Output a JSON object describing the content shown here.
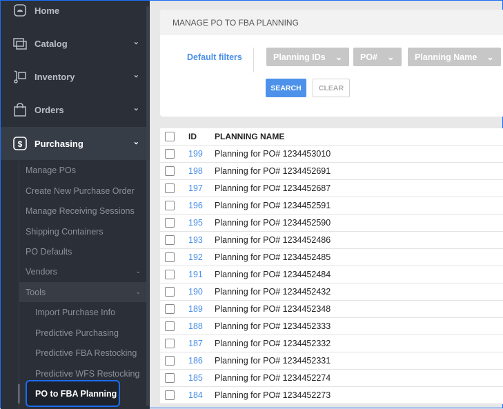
{
  "sidebar": {
    "top_items": [
      {
        "label": "Home",
        "icon": "home-icon"
      },
      {
        "label": "Catalog",
        "icon": "catalog-icon"
      },
      {
        "label": "Inventory",
        "icon": "inventory-icon"
      },
      {
        "label": "Orders",
        "icon": "orders-icon"
      },
      {
        "label": "Purchasing",
        "icon": "dollar-icon"
      }
    ],
    "sub_items": [
      "Manage POs",
      "Create New Purchase Order",
      "Manage Receiving Sessions",
      "Shipping Containers",
      "PO Defaults",
      "Vendors",
      "Tools"
    ],
    "tools_items": [
      "Import Purchase Info",
      "Predictive Purchasing",
      "Predictive FBA Restocking",
      "Predictive WFS Restocking"
    ],
    "active_item": "PO to FBA Planning"
  },
  "card": {
    "title": "MANAGE PO TO FBA PLANNING",
    "default_filters": "Default filters",
    "filters": [
      "Planning IDs",
      "PO#",
      "Planning Name"
    ],
    "search": "SEARCH",
    "clear": "CLEAR"
  },
  "table": {
    "headers": {
      "id": "ID",
      "name": "PLANNING NAME"
    },
    "rows": [
      {
        "id": "199",
        "name": "Planning for PO# 1234453010"
      },
      {
        "id": "198",
        "name": "Planning for PO# 1234452691"
      },
      {
        "id": "197",
        "name": "Planning for PO# 1234452687"
      },
      {
        "id": "196",
        "name": "Planning for PO# 1234452591"
      },
      {
        "id": "195",
        "name": "Planning for PO# 1234452590"
      },
      {
        "id": "193",
        "name": "Planning for PO# 1234452486"
      },
      {
        "id": "192",
        "name": "Planning for PO# 1234452485"
      },
      {
        "id": "191",
        "name": "Planning for PO# 1234452484"
      },
      {
        "id": "190",
        "name": "Planning for PO# 1234452432"
      },
      {
        "id": "189",
        "name": "Planning for PO# 1234452348"
      },
      {
        "id": "188",
        "name": "Planning for PO# 1234452333"
      },
      {
        "id": "187",
        "name": "Planning for PO# 1234452332"
      },
      {
        "id": "186",
        "name": "Planning for PO# 1234452331"
      },
      {
        "id": "185",
        "name": "Planning for PO# 1234452274"
      },
      {
        "id": "184",
        "name": "Planning for PO# 1234452273"
      }
    ]
  }
}
